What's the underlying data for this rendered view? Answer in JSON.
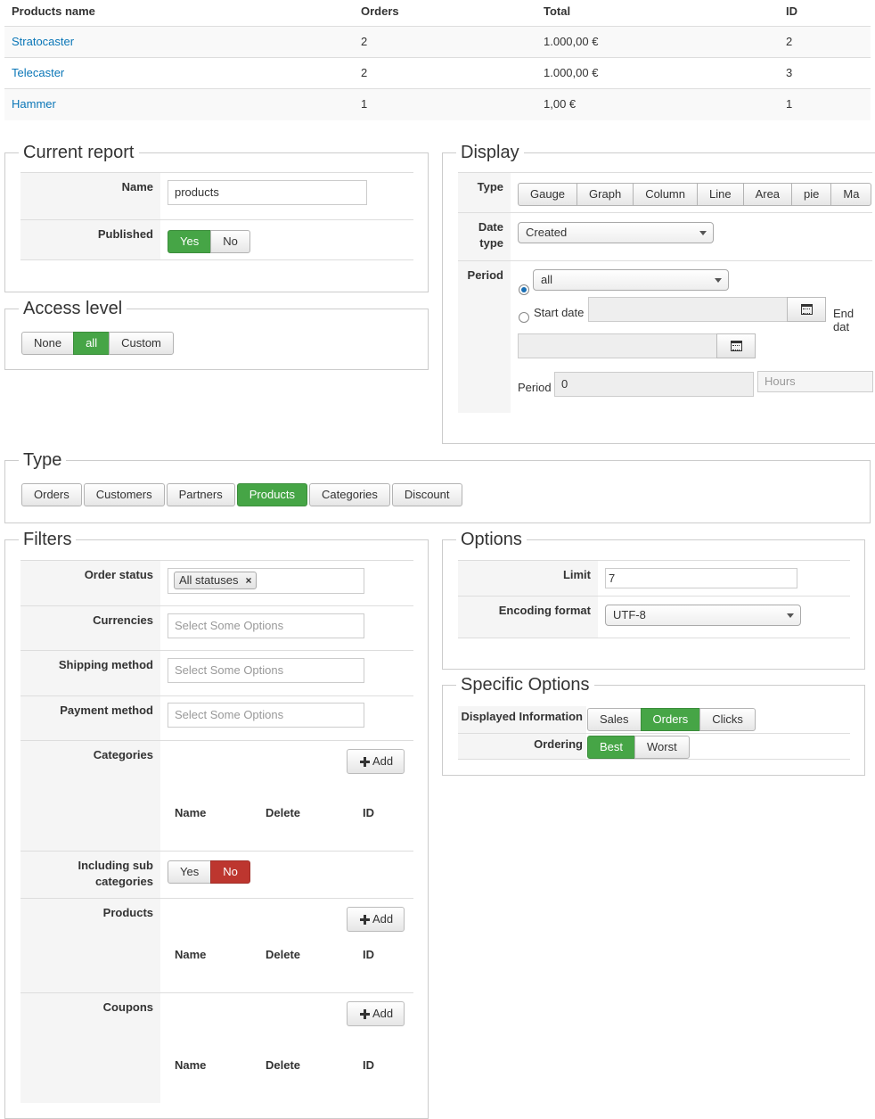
{
  "results_table": {
    "headers": [
      "Products name",
      "Orders",
      "Total",
      "ID"
    ],
    "rows": [
      {
        "name": "Stratocaster",
        "orders": "2",
        "total": "1.000,00 €",
        "id": "2"
      },
      {
        "name": "Telecaster",
        "orders": "2",
        "total": "1.000,00 €",
        "id": "3"
      },
      {
        "name": "Hammer",
        "orders": "1",
        "total": "1,00 €",
        "id": "1"
      }
    ]
  },
  "current_report": {
    "legend": "Current report",
    "name_label": "Name",
    "name_value": "products",
    "published_label": "Published",
    "published_options": [
      "Yes",
      "No"
    ],
    "published_selected": "Yes"
  },
  "access_level": {
    "legend": "Access level",
    "options": [
      "None",
      "all",
      "Custom"
    ],
    "selected": "all"
  },
  "display": {
    "legend": "Display",
    "type_label": "Type",
    "type_options": [
      "Gauge",
      "Graph",
      "Column",
      "Line",
      "Area",
      "pie",
      "Ma"
    ],
    "date_type_label": "Date type",
    "date_type_value": "Created",
    "period_label": "Period",
    "period_value": "all",
    "start_date_label": "Start date",
    "end_date_label": "End dat",
    "period_field_label": "Period",
    "period_amount": "0",
    "period_unit": "Hours"
  },
  "type_section": {
    "legend": "Type",
    "options": [
      "Orders",
      "Customers",
      "Partners",
      "Products",
      "Categories",
      "Discount"
    ],
    "selected": "Products"
  },
  "filters": {
    "legend": "Filters",
    "order_status_label": "Order status",
    "order_status_tag": "All statuses",
    "currencies_label": "Currencies",
    "shipping_label": "Shipping method",
    "payment_label": "Payment method",
    "select_placeholder": "Select Some Options",
    "categories_label": "Categories",
    "add_label": "Add",
    "col_name": "Name",
    "col_delete": "Delete",
    "col_id": "ID",
    "including_sub_label": "Including sub categories",
    "including_sub_options": [
      "Yes",
      "No"
    ],
    "including_sub_selected": "No",
    "products_label": "Products",
    "coupons_label": "Coupons"
  },
  "options": {
    "legend": "Options",
    "limit_label": "Limit",
    "limit_value": "7",
    "encoding_label": "Encoding format",
    "encoding_value": "UTF-8"
  },
  "specific_options": {
    "legend": "Specific Options",
    "displayed_info_label": "Displayed Information",
    "displayed_info_options": [
      "Sales",
      "Orders",
      "Clicks"
    ],
    "displayed_info_selected": "Orders",
    "ordering_label": "Ordering",
    "ordering_options": [
      "Best",
      "Worst"
    ],
    "ordering_selected": "Best"
  },
  "colors": {
    "accent_green": "#46a546",
    "accent_red": "#bd362f",
    "link": "#0a76b7"
  }
}
